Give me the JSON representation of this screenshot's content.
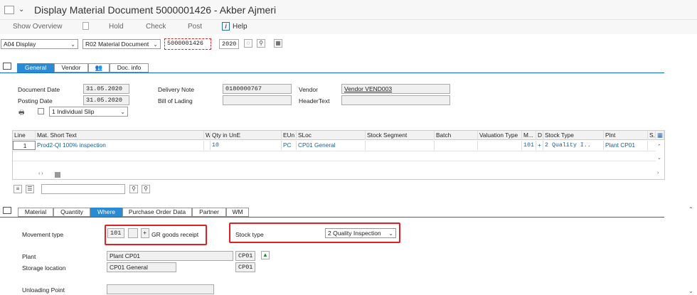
{
  "title": "Display Material Document 5000001426 - Akber Ajmeri",
  "toolbar": {
    "show_overview": "Show Overview",
    "hold": "Hold",
    "check": "Check",
    "post": "Post",
    "help": "Help"
  },
  "header": {
    "action_select": "A04 Display",
    "ref_select": "R02 Material Document",
    "doc_number": "5000001426",
    "doc_year": "2020"
  },
  "top_tabs": [
    "General",
    "Vendor",
    "",
    "Doc. info"
  ],
  "general": {
    "document_date_label": "Document Date",
    "document_date": "31.05.2020",
    "posting_date_label": "Posting Date",
    "posting_date": "31.05.2020",
    "delivery_note_label": "Delivery Note",
    "delivery_note": "0180000767",
    "bill_of_lading_label": "Bill of Lading",
    "vendor_label": "Vendor",
    "vendor_value": "Vendor VEND003",
    "header_text_label": "HeaderText",
    "slip_select": "1 Individual Slip"
  },
  "grid": {
    "columns": [
      "Line",
      "Mat. Short Text",
      "W",
      "Qty in UnE",
      "EUn",
      "SLoc",
      "Stock Segment",
      "Batch",
      "Valuation Type",
      "M...",
      "D",
      "Stock Type",
      "Plnt",
      "S."
    ],
    "row": {
      "line": "1",
      "mat_short_text": "Prod2-QI 100% inspection",
      "qty": "10",
      "eun": "PC",
      "sloc": "CP01 General",
      "m": "101",
      "d": "+",
      "stock_type": "2 Quality I..",
      "plnt": "Plant CP01"
    }
  },
  "item_tabs": [
    "Material",
    "Quantity",
    "Where",
    "Purchase Order Data",
    "Partner",
    "WM"
  ],
  "where": {
    "movement_type_label": "Movement type",
    "movement_type": "101",
    "movement_sign": "+",
    "movement_text": "GR goods receipt",
    "stock_type_label": "Stock type",
    "stock_type_select": "2 Quality Inspection",
    "plant_label": "Plant",
    "plant_value": "Plant CP01",
    "plant_code": "CP01",
    "storage_location_label": "Storage location",
    "storage_location_value": "CP01 General",
    "storage_location_code": "CP01",
    "unloading_point_label": "Unloading Point"
  }
}
